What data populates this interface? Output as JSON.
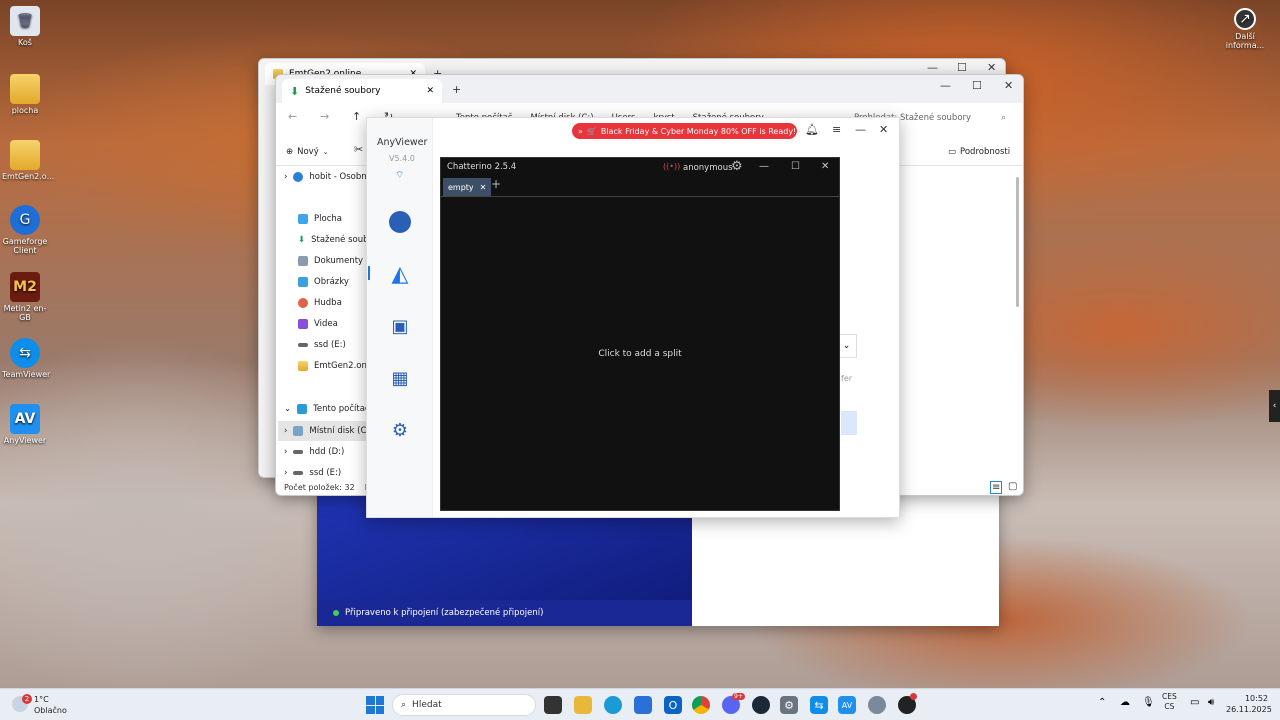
{
  "desktop": {
    "icons": [
      {
        "label": "Koš",
        "icon": "recycle-bin-icon"
      },
      {
        "label": "plocha",
        "icon": "folder-icon"
      },
      {
        "label": "EmtGen2.o...",
        "icon": "folder-icon"
      },
      {
        "label": "Gameforge Client",
        "icon": "gameforge-icon"
      },
      {
        "label": "Metin2 en-GB",
        "icon": "metin2-icon"
      },
      {
        "label": "TeamViewer",
        "icon": "teamviewer-icon"
      },
      {
        "label": "AnyViewer",
        "icon": "anyviewer-icon"
      }
    ],
    "right_icon_label": "Další informa..."
  },
  "explorer_back": {
    "tab_title": "EmtGen2.online"
  },
  "explorer": {
    "tab_title": "Stažené soubory",
    "breadcrumb": [
      "Tento počítač",
      "Místní disk (C:)",
      "Users",
      "kryst",
      "Stažené soubory"
    ],
    "search_placeholder": "Prohledat: Stažené soubory",
    "new_label": "Nový",
    "details_label": "Podrobnosti",
    "nav": [
      {
        "label": "hobit - Osobní"
      },
      {
        "label": "Plocha"
      },
      {
        "label": "Stažené soub"
      },
      {
        "label": "Dokumenty"
      },
      {
        "label": "Obrázky"
      },
      {
        "label": "Hudba"
      },
      {
        "label": "Videa"
      },
      {
        "label": "ssd (E:)"
      },
      {
        "label": "EmtGen2.online"
      },
      {
        "label": "Tento počítač"
      },
      {
        "label": "Místní disk (C:"
      },
      {
        "label": "hdd (D:)"
      },
      {
        "label": "ssd (E:)"
      }
    ],
    "status": "Počet položek: 32",
    "status2": "Po"
  },
  "anyviewer": {
    "title": "AnyViewer",
    "version": "V5.4.0",
    "promo": "Black Friday & Cyber Monday 80% OFF is Ready!",
    "partial_text": "fer"
  },
  "chatterino": {
    "title": "Chatterino 2.5.4",
    "user": "anonymous",
    "tab": "empty",
    "placeholder": "Click to add a split"
  },
  "teamviewer_bg": {
    "status": "Připraveno k připojení (zabezpečené připojení)"
  },
  "taskbar": {
    "weather_temp": "1°C",
    "weather_desc": "Oblačno",
    "weather_badge": "2",
    "search_placeholder": "Hledat",
    "lang_top": "CES",
    "lang_bottom": "CS",
    "time": "10:52",
    "date": "26.11.2025",
    "discord_badge": "9+"
  },
  "colors": {
    "accent_red": "#e8343b",
    "chat_bg": "#111111",
    "teamviewer_blue": "#1b2a8f",
    "online_green": "#3fcf5a"
  }
}
